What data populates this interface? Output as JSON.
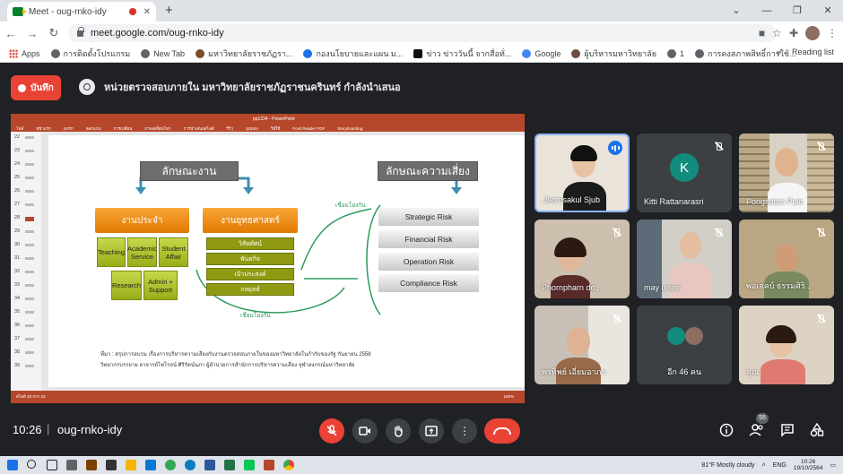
{
  "browser": {
    "tab_title": "Meet - oug-rnko-idy",
    "url": "meet.google.com/oug-rnko-idy",
    "bookmarks": [
      {
        "label": "Apps",
        "icon": "apps-icon"
      },
      {
        "label": "การติดตั้งโปรแกรม",
        "icon": "globe-icon"
      },
      {
        "label": "New Tab",
        "icon": "globe-icon"
      },
      {
        "label": "มหาวิทยาลัยราชภัฏรา...",
        "icon": "site-icon"
      },
      {
        "label": "กองนโยบายและแผน ม...",
        "icon": "site-icon"
      },
      {
        "label": "ข่าว ข่าววันนี้ จากสื่อทั่...",
        "icon": "news-icon"
      },
      {
        "label": "Google",
        "icon": "google-icon"
      },
      {
        "label": "ผู้บริหารมหาวิทยาลัย",
        "icon": "site-icon"
      },
      {
        "label": "1",
        "icon": "globe-icon"
      },
      {
        "label": "การคงสภาพสิทธิ์การใช้...",
        "icon": "globe-icon"
      }
    ],
    "reading_list": "Reading list"
  },
  "meet": {
    "record_label": "บันทึก",
    "presenting_text": "หน่วยตรวจสอบภายใน มหาวิทยาลัยราชภัฏราชนครินทร์ กำลังนำเสนอ",
    "meeting_time": "10:26",
    "separator": "|",
    "meeting_code": "oug-rnko-idy",
    "people_count": "55"
  },
  "powerpoint": {
    "file_title": "pp1234 - PowerPoint",
    "ribbon_tabs": [
      "ไฟล์",
      "หน้าแรก",
      "แทรก",
      "ออกแบบ",
      "การเปลี่ยน",
      "ภาพเคลื่อนไหว",
      "การนำเสนอสไลด์",
      "รีวิว",
      "มุมมอง",
      "วิธีใช้",
      "Foxit Reader PDF",
      "Storyboarding"
    ],
    "slide_numbers": [
      "22",
      "23",
      "24",
      "25",
      "26",
      "27",
      "28",
      "29",
      "30",
      "31",
      "32",
      "33",
      "34",
      "35",
      "36",
      "37",
      "38",
      "39"
    ],
    "status_text": "สไลด์ 28 จาก 43",
    "zoom": "100%"
  },
  "slide": {
    "left_header": "ลักษณะงาน",
    "right_header": "ลักษณะความเสี่ยง",
    "routine_work": "งานประจำ",
    "strategic_work": "งานยุทธศาสตร์",
    "routine_items": [
      "Teaching",
      "Academic Service",
      "Student Affair",
      "Research",
      "Admin + Support"
    ],
    "strategic_items": [
      "วิสัยทัศน์",
      "พันธกิจ",
      "เป้าประสงค์",
      "กลยุทธ์"
    ],
    "risks": [
      "Strategic Risk",
      "Financial Risk",
      "Operation Risk",
      "Compliance Risk"
    ],
    "link_label": "เชื่อมโยงกัน",
    "source_line1": "ที่มา : สรุปการอบรม เรื่องการบริหารความเสี่ยงกับงานตรวจสอบภายในของมหาวิทยาลัยในกำกับของรัฐ  กันยายน 2558",
    "source_line2": "วิทยากรบรรยาย อาจารย์ไพโรจน์ ศิริรัตน์นภา ผู้อำนวยการสำนักการบริหารความเสี่ยง จุฬาลงกรณ์มหาวิทยาลัย"
  },
  "participants": [
    {
      "name": "Jsomsakul Sjub",
      "status": "speaking"
    },
    {
      "name": "Kitti Rattanarasri",
      "status": "muted",
      "initial": "K"
    },
    {
      "name": "Pongsaton Pule",
      "status": "muted"
    },
    {
      "name": "Phornpharn do...",
      "status": "muted"
    },
    {
      "name": "may u ree",
      "status": "muted"
    },
    {
      "name": "พอเจคบ์ ธรรมศิริ...",
      "status": "muted"
    },
    {
      "name": "พรทิพย์ เอี่ยมอาภา",
      "status": "muted"
    },
    {
      "name": "อีก 46 คน",
      "status": "others"
    },
    {
      "name": "คุณ",
      "status": "muted"
    }
  ],
  "taskbar": {
    "weather": "81°F  Mostly cloudy",
    "lang": "ENG",
    "time": "10:26",
    "date": "19/10/2564"
  },
  "colors": {
    "record_red": "#ea4335",
    "meet_bg": "#202124",
    "active_speaker": "#1a73e8",
    "ppt_accent": "#b7472a"
  }
}
